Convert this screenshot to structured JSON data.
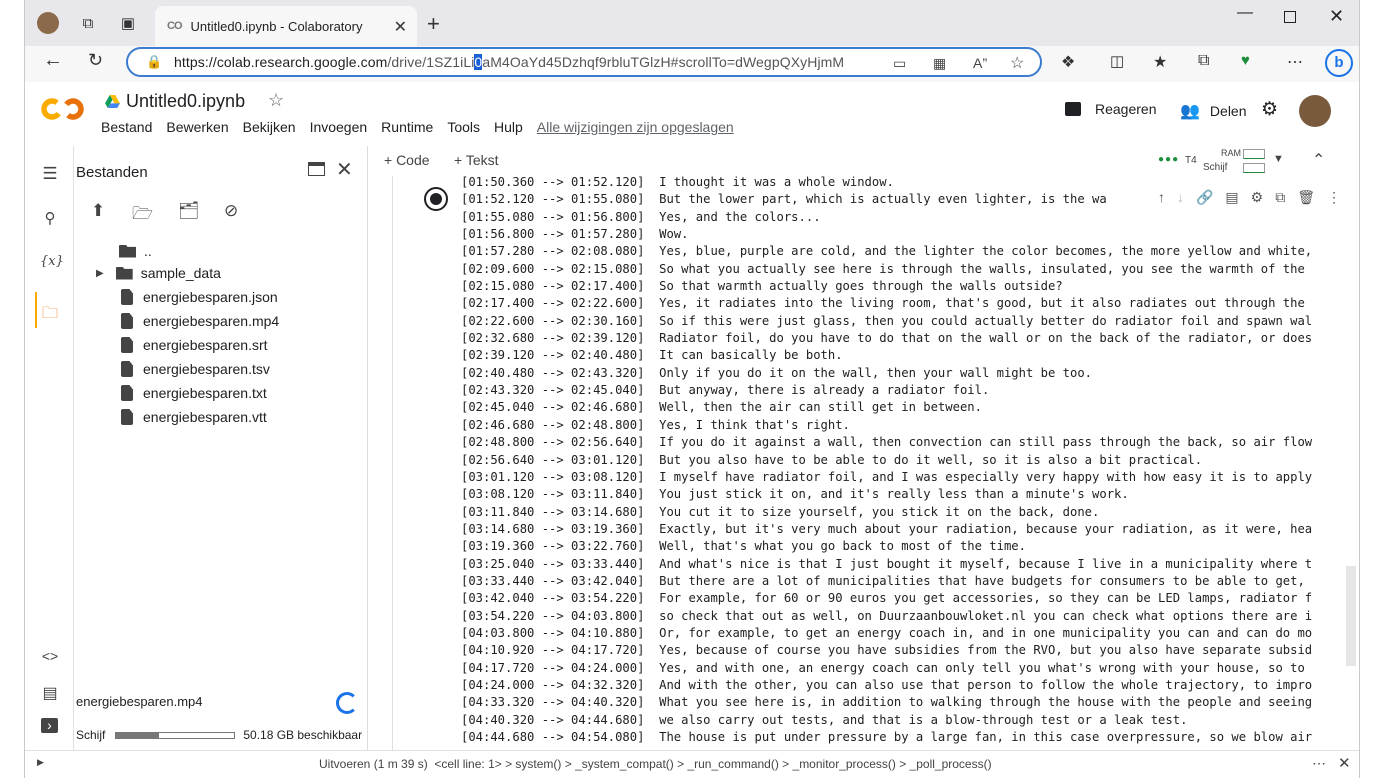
{
  "browser": {
    "tab_title": "Untitled0.ipynb - Colaboratory",
    "url_host": "https://colab.research.google.com",
    "url_path_a": "/drive/1SZ1iLi",
    "url_selected": "0",
    "url_path_b": "aM4OaYd45Dzhqf9rbluTGlzH#scrollTo=dWegpQXyHjmM"
  },
  "colab": {
    "notebook_name": "Untitled0.ipynb",
    "menus": [
      "Bestand",
      "Bewerken",
      "Bekijken",
      "Invoegen",
      "Runtime",
      "Tools",
      "Hulp"
    ],
    "saved_status": "Alle wijzigingen zijn opgeslagen",
    "comment_label": "Reageren",
    "share_label": "Delen"
  },
  "files": {
    "title": "Bestanden",
    "parent": "..",
    "items": [
      "sample_data",
      "energiebesparen.json",
      "energiebesparen.mp4",
      "energiebesparen.srt",
      "energiebesparen.tsv",
      "energiebesparen.txt",
      "energiebesparen.vtt"
    ],
    "uploading": "energiebesparen.mp4",
    "disk_label": "Schijf",
    "disk_available": "50.18 GB beschikbaar",
    "disk_used_fraction": 0.36
  },
  "notebook": {
    "add_code": "+ Code",
    "add_text": "+ Tekst",
    "runtime": "T4",
    "ram_label": "RAM",
    "disk_label": "Schijf"
  },
  "output_lines": [
    "[01:50.360 --> 01:52.120]  I thought it was a whole window.",
    "[01:52.120 --> 01:55.080]  But the lower part, which is actually even lighter, is the wa",
    "[01:55.080 --> 01:56.800]  Yes, and the colors...",
    "[01:56.800 --> 01:57.280]  Wow.",
    "[01:57.280 --> 02:08.080]  Yes, blue, purple are cold, and the lighter the color becomes, the more yellow and white,",
    "[02:09.600 --> 02:15.080]  So what you actually see here is through the walls, insulated, you see the warmth of the",
    "[02:15.080 --> 02:17.400]  So that warmth actually goes through the walls outside?",
    "[02:17.400 --> 02:22.600]  Yes, it radiates into the living room, that's good, but it also radiates out through the",
    "[02:22.600 --> 02:30.160]  So if this were just glass, then you could actually better do radiator foil and spawn wal",
    "[02:32.680 --> 02:39.120]  Radiator foil, do you have to do that on the wall or on the back of the radiator, or does",
    "[02:39.120 --> 02:40.480]  It can basically be both.",
    "[02:40.480 --> 02:43.320]  Only if you do it on the wall, then your wall might be too.",
    "[02:43.320 --> 02:45.040]  But anyway, there is already a radiator foil.",
    "[02:45.040 --> 02:46.680]  Well, then the air can still get in between.",
    "[02:46.680 --> 02:48.800]  Yes, I think that's right.",
    "[02:48.800 --> 02:56.640]  If you do it against a wall, then convection can still pass through the back, so air flow",
    "[02:56.640 --> 03:01.120]  But you also have to be able to do it well, so it is also a bit practical.",
    "[03:01.120 --> 03:08.120]  I myself have radiator foil, and I was especially very happy with how easy it is to apply",
    "[03:08.120 --> 03:11.840]  You just stick it on, and it's really less than a minute's work.",
    "[03:11.840 --> 03:14.680]  You cut it to size yourself, you stick it on the back, done.",
    "[03:14.680 --> 03:19.360]  Exactly, but it's very much about your radiation, because your radiation, as it were, hea",
    "[03:19.360 --> 03:22.760]  Well, that's what you go back to most of the time.",
    "[03:25.040 --> 03:33.440]  And what's nice is that I just bought it myself, because I live in a municipality where t",
    "[03:33.440 --> 03:42.040]  But there are a lot of municipalities that have budgets for consumers to be able to get,",
    "[03:42.040 --> 03:54.220]  For example, for 60 or 90 euros you get accessories, so they can be LED lamps, radiator f",
    "[03:54.220 --> 04:03.800]  so check that out as well, on Duurzaanbouwloket.nl you can check what options there are i",
    "[04:03.800 --> 04:10.880]  Or, for example, to get an energy coach in, and in one municipality you can and can do mo",
    "[04:10.920 --> 04:17.720]  Yes, because of course you have subsidies from the RVO, but you also have separate subsid",
    "[04:17.720 --> 04:24.000]  Yes, and with one, an energy coach can only tell you what's wrong with your house, so to",
    "[04:24.000 --> 04:32.320]  And with the other, you can also use that person to follow the whole trajectory, to impro",
    "[04:33.320 --> 04:40.320]  What you see here is, in addition to walking through the house with the people and seeing",
    "[04:40.320 --> 04:44.680]  we also carry out tests, and that is a blow-through test or a leak test.",
    "[04:44.680 --> 04:54.080]  The house is put under pressure by a large fan, in this case overpressure, so we blow air"
  ],
  "status_bar": "Uitvoeren (1 m 39 s)  <cell line: 1> > system() > _system_compat() > _run_command() > _monitor_process() > _poll_process()"
}
